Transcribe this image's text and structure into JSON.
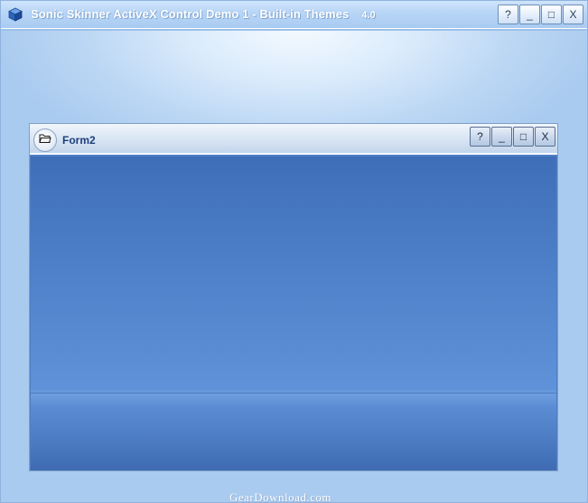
{
  "outer_window": {
    "title": "Sonic Skinner ActiveX Control Demo 1 - Built-in Themes",
    "version_mark": "4.0",
    "buttons": {
      "help": "?",
      "minimize": "_",
      "maximize": "□",
      "close": "X"
    }
  },
  "inner_form": {
    "title": "Form2",
    "buttons": {
      "help": "?",
      "minimize": "_",
      "maximize": "□",
      "close": "X"
    }
  },
  "watermark": {
    "text": "GearDownload.com"
  },
  "icons": {
    "app": "app-cube-icon",
    "form": "folder-icon"
  },
  "colors": {
    "titlebar_text": "#ffffff",
    "form_title_text": "#1f3f7a",
    "client_top": "#3f6eb8",
    "client_bottom": "#5f92d8"
  }
}
